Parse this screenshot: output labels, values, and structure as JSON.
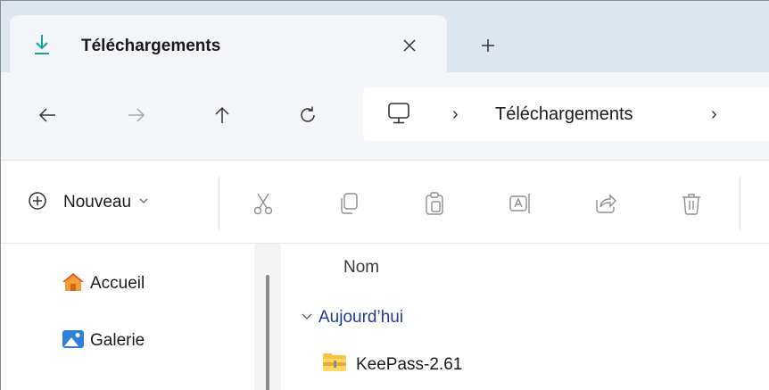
{
  "tab": {
    "title": "Téléchargements",
    "icon": "download-icon",
    "accent": "#1aa39a"
  },
  "nav": {
    "back_icon": "arrow-left-icon",
    "forward_icon": "arrow-right-icon",
    "up_icon": "arrow-up-icon",
    "refresh_icon": "refresh-icon",
    "location_icon": "computer-icon",
    "separator": "›",
    "crumb": "Téléchargements"
  },
  "toolbar": {
    "new_label": "Nouveau",
    "tools": [
      "cut-icon",
      "copy-icon",
      "paste-icon",
      "rename-icon",
      "share-icon",
      "delete-icon"
    ]
  },
  "sidebar": {
    "items": [
      {
        "label": "Accueil",
        "icon": "home-icon"
      },
      {
        "label": "Galerie",
        "icon": "gallery-icon"
      }
    ]
  },
  "main": {
    "column_name": "Nom",
    "group": "Aujourd’hui",
    "files": [
      {
        "name": "KeePass-2.61",
        "icon": "zip-folder-icon"
      }
    ]
  }
}
